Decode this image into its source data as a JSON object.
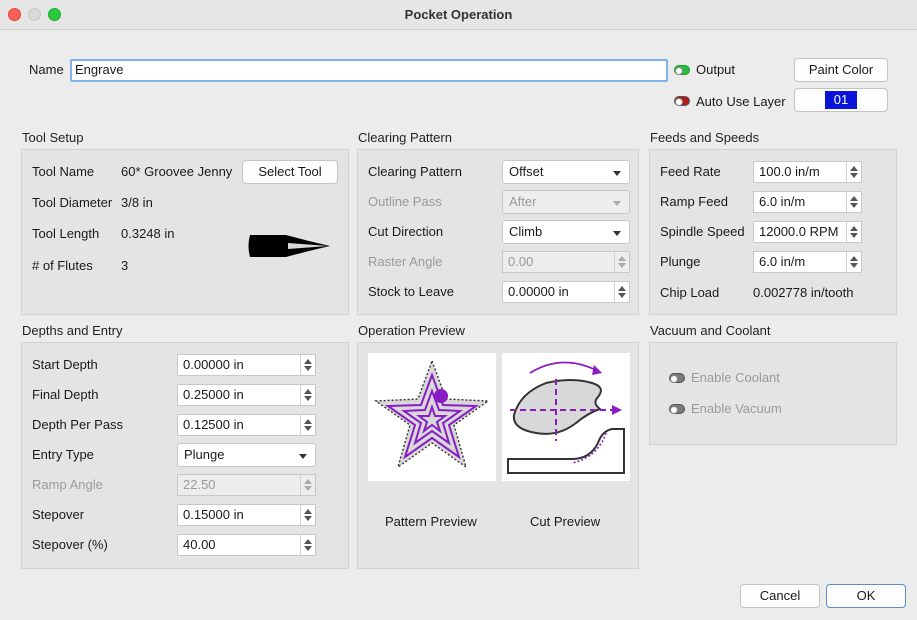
{
  "window": {
    "title": "Pocket Operation"
  },
  "name_field": {
    "label": "Name",
    "value": "Engrave"
  },
  "output": {
    "label": "Output",
    "enabled": true
  },
  "auto_use_layer": {
    "label": "Auto Use Layer",
    "enabled": false
  },
  "paint_color_button": "Paint Color",
  "layer": {
    "value": "01",
    "color": "#0a14d8"
  },
  "tool_setup": {
    "title": "Tool Setup",
    "tool_name_label": "Tool Name",
    "tool_name_value": "60* Groovee Jenny",
    "select_tool_button": "Select Tool",
    "tool_diameter_label": "Tool Diameter",
    "tool_diameter_value": "3/8 in",
    "tool_length_label": "Tool Length",
    "tool_length_value": "0.3248 in",
    "flutes_label": "# of Flutes",
    "flutes_value": "3"
  },
  "clearing_pattern": {
    "title": "Clearing Pattern",
    "pattern_label": "Clearing Pattern",
    "pattern_value": "Offset",
    "outline_pass_label": "Outline Pass",
    "outline_pass_value": "After",
    "cut_direction_label": "Cut Direction",
    "cut_direction_value": "Climb",
    "raster_angle_label": "Raster Angle",
    "raster_angle_value": "0.00",
    "stock_to_leave_label": "Stock to Leave",
    "stock_to_leave_value": "0.00000 in"
  },
  "feeds_speeds": {
    "title": "Feeds and Speeds",
    "feed_rate_label": "Feed Rate",
    "feed_rate_value": "100.0 in/m",
    "ramp_feed_label": "Ramp Feed",
    "ramp_feed_value": "6.0 in/m",
    "spindle_speed_label": "Spindle Speed",
    "spindle_speed_value": "12000.0 RPM",
    "plunge_label": "Plunge",
    "plunge_value": "6.0 in/m",
    "chip_load_label": "Chip Load",
    "chip_load_value": "0.002778 in/tooth"
  },
  "depths_entry": {
    "title": "Depths and Entry",
    "start_depth_label": "Start Depth",
    "start_depth_value": "0.00000 in",
    "final_depth_label": "Final Depth",
    "final_depth_value": "0.25000 in",
    "depth_per_pass_label": "Depth Per Pass",
    "depth_per_pass_value": "0.12500 in",
    "entry_type_label": "Entry Type",
    "entry_type_value": "Plunge",
    "ramp_angle_label": "Ramp Angle",
    "ramp_angle_value": "22.50",
    "stepover_label": "Stepover",
    "stepover_value": "0.15000 in",
    "stepover_pct_label": "Stepover (%)",
    "stepover_pct_value": "40.00"
  },
  "operation_preview": {
    "title": "Operation Preview",
    "pattern_preview_label": "Pattern Preview",
    "cut_preview_label": "Cut Preview",
    "accent_color": "#8a1cc4"
  },
  "vacuum_coolant": {
    "title": "Vacuum and Coolant",
    "enable_coolant_label": "Enable Coolant",
    "enable_vacuum_label": "Enable Vacuum"
  },
  "footer": {
    "cancel_button": "Cancel",
    "ok_button": "OK"
  }
}
